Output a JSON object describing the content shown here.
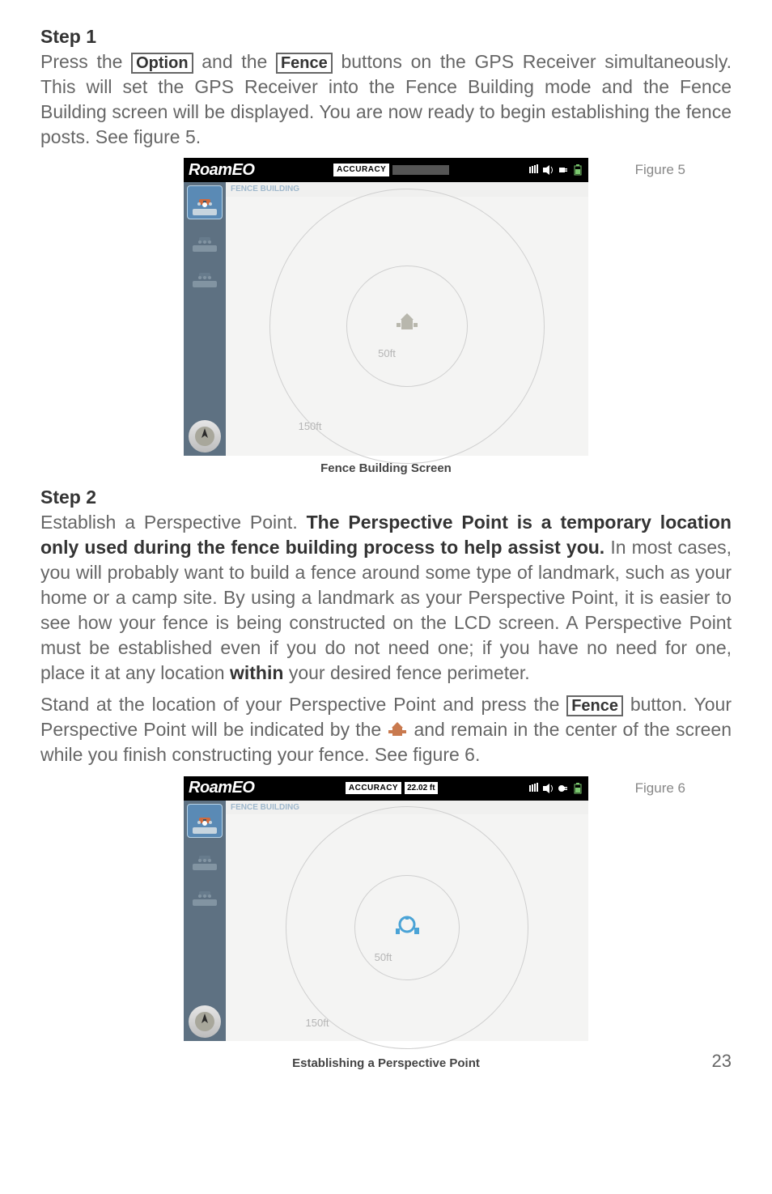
{
  "step1_label": "Step 1",
  "step1_text_a": "Press the ",
  "btn_option": "Option",
  "step1_text_b": " and the ",
  "btn_fence": "Fence",
  "step1_text_c": " buttons on the GPS Receiver simultaneously. This will set the GPS Receiver into the Fence Building mode and the Fence Building screen will be displayed. You are now ready to begin establishing the fence posts. See figure 5.",
  "figure5_label": "Figure 5",
  "figure6_label": "Figure 6",
  "brand": "RoamEO",
  "accuracy_label": "ACCURACY",
  "accuracy_value": "22.02 ft",
  "fb_title": "FENCE BUILDING",
  "ring_inner_label": "50ft",
  "ring_outer_label": "150ft",
  "caption5": "Fence Building Screen",
  "caption6": "Establishing a Perspective Point",
  "step2_label": "Step 2",
  "step2_text_a": "Establish a Perspective Point. ",
  "step2_bold": "The Perspective Point is a temporary location only used during the fence building process to help assist you.",
  "step2_text_b": " In most cases, you will probably want to build a fence around some type of landmark, such as your home or a camp site. By using a landmark as your Perspective Point, it is easier to see how your fence is being constructed on the LCD screen. A Perspective Point must be established even if you do not need one; if you have no need for one, place it at any location ",
  "step2_bold2": "within",
  "step2_text_c": " your desired fence perimeter.",
  "step2_p2_a": "Stand at the location of your Perspective Point and press the ",
  "step2_p2_b": " button. Your Perspective Point will be indicated by the ",
  "step2_p2_c": " and remain in the center of the screen while you finish constructing your fence. See figure 6.",
  "page_number": "23"
}
